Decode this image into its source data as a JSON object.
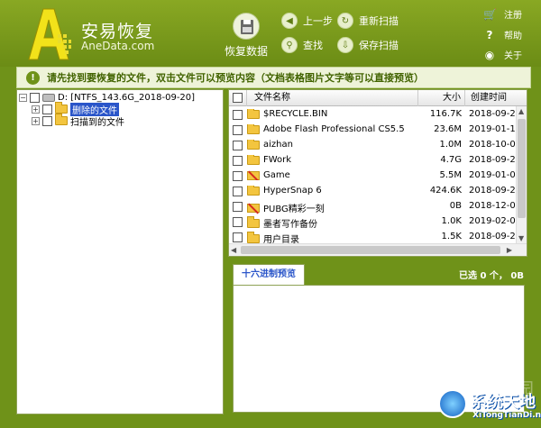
{
  "app": {
    "name": "安易恢复",
    "site": "AneData.com",
    "logo_letter": "A"
  },
  "toolbar": {
    "recover_label": "恢复数据",
    "prev_label": "上一步",
    "search_label": "查找",
    "rescan_label": "重新扫描",
    "save_scan_label": "保存扫描"
  },
  "side_menu": {
    "register": "注册",
    "help": "帮助",
    "about": "关于"
  },
  "tip": {
    "icon": "!",
    "text": "请先找到要恢复的文件，双击文件可以预览内容（文档表格图片文字等可以直接预览）"
  },
  "tree": {
    "root_label": "D:  [NTFS_143.6G_2018-09-20]",
    "children": [
      {
        "label": "删除的文件"
      },
      {
        "label": "扫描到的文件"
      }
    ]
  },
  "filelist": {
    "headers": {
      "name": "文件名称",
      "size": "大小",
      "date": "创建时间"
    },
    "rows": [
      {
        "name": "$RECYCLE.BIN",
        "size": "116.7K",
        "date": "2018-09-2",
        "deleted": false
      },
      {
        "name": "Adobe Flash Professional CS5.5",
        "size": "23.6M",
        "date": "2019-01-1",
        "deleted": false
      },
      {
        "name": "aizhan",
        "size": "1.0M",
        "date": "2018-10-0",
        "deleted": false
      },
      {
        "name": "FWork",
        "size": "4.7G",
        "date": "2018-09-2",
        "deleted": false
      },
      {
        "name": "Game",
        "size": "5.5M",
        "date": "2019-01-0",
        "deleted": true
      },
      {
        "name": "HyperSnap 6",
        "size": "424.6K",
        "date": "2018-09-2",
        "deleted": false
      },
      {
        "name": "PUBG精彩一刻",
        "size": "0B",
        "date": "2018-12-0",
        "deleted": true
      },
      {
        "name": "墨者写作备份",
        "size": "1.0K",
        "date": "2019-02-0",
        "deleted": false
      },
      {
        "name": "用户目录",
        "size": "1.5K",
        "date": "2018-09-2",
        "deleted": false
      }
    ]
  },
  "preview": {
    "tab_label": "十六进制预览",
    "selected_info": "已选 0 个， 0B"
  },
  "watermark": {
    "ghost_text": "当下软件园",
    "title": "系统天地",
    "url": "XiTongTianDi.net"
  },
  "colors": {
    "frame_green": "#6f9219",
    "tip_bg": "#eef3d9",
    "selection_blue": "#2a55c9",
    "folder_yellow": "#f3c53f",
    "deleted_red": "#d62a1e"
  }
}
